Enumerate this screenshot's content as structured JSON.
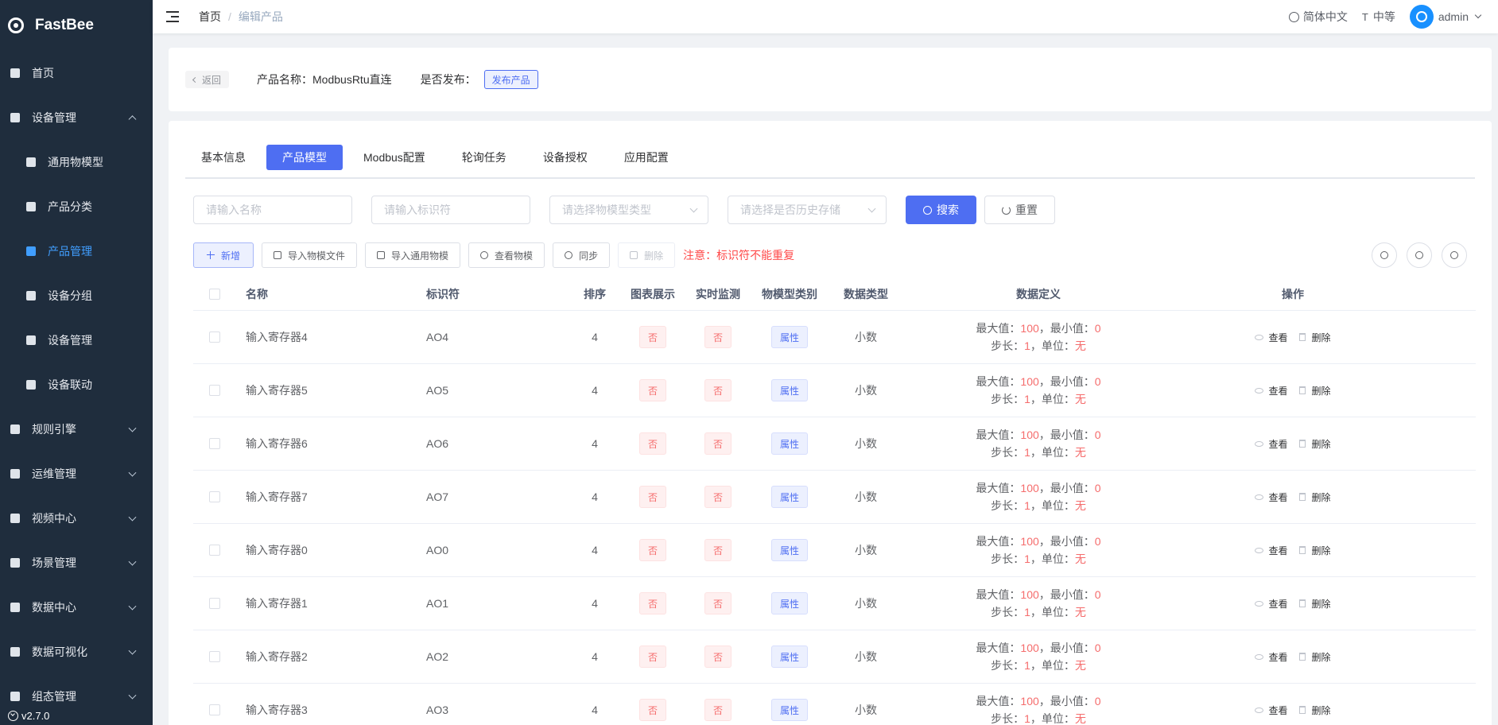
{
  "app": {
    "name": "FastBee",
    "version": "v2.7.0"
  },
  "sidebar": {
    "items": [
      {
        "label": "首页"
      },
      {
        "label": "设备管理"
      },
      {
        "label": "通用物模型"
      },
      {
        "label": "产品分类"
      },
      {
        "label": "产品管理"
      },
      {
        "label": "设备分组"
      },
      {
        "label": "设备管理"
      },
      {
        "label": "设备联动"
      },
      {
        "label": "规则引擎"
      },
      {
        "label": "运维管理"
      },
      {
        "label": "视频中心"
      },
      {
        "label": "场景管理"
      },
      {
        "label": "数据中心"
      },
      {
        "label": "数据可视化"
      },
      {
        "label": "组态管理"
      }
    ]
  },
  "header": {
    "breadcrumb": {
      "home": "首页",
      "sep": "/",
      "current": "编辑产品"
    },
    "language": "简体中文",
    "size": "中等",
    "user": "admin"
  },
  "product_bar": {
    "back_label": "返回",
    "product_name": "产品名称：ModbusRtu直连",
    "publish_label": "是否发布：",
    "publish_button": "发布产品"
  },
  "tabs": [
    {
      "label": "基本信息"
    },
    {
      "label": "产品模型"
    },
    {
      "label": "Modbus配置"
    },
    {
      "label": "轮询任务"
    },
    {
      "label": "设备授权"
    },
    {
      "label": "应用配置"
    }
  ],
  "filters": {
    "name_placeholder": "请输入名称",
    "identifier_placeholder": "请输入标识符",
    "model_type_placeholder": "请选择物模型类型",
    "history_placeholder": "请选择是否历史存储",
    "search_label": "搜索",
    "reset_label": "重置"
  },
  "toolbar": {
    "add": "新增",
    "import_file": "导入物模文件",
    "import_common": "导入通用物模",
    "view": "查看物模",
    "sync": "同步",
    "delete": "删除",
    "warning": "注意：标识符不能重复"
  },
  "table": {
    "headers": {
      "name": "名称",
      "identifier": "标识符",
      "order": "排序",
      "chart": "图表展示",
      "monitor": "实时监测",
      "category": "物模型类别",
      "data_type": "数据类型",
      "definition": "数据定义",
      "ops": "操作"
    },
    "labels": {
      "max": "最大值：",
      "min": "，最小值：",
      "step": "步长：",
      "unit": "，单位：",
      "view": "查看",
      "delete": "删除"
    },
    "rows": [
      {
        "name": "输入寄存器4",
        "identifier": "AO4",
        "order": "4",
        "chart": "否",
        "monitor": "否",
        "category": "属性",
        "data_type": "小数",
        "max": "100",
        "min": "0",
        "step": "1",
        "unit": "无"
      },
      {
        "name": "输入寄存器5",
        "identifier": "AO5",
        "order": "4",
        "chart": "否",
        "monitor": "否",
        "category": "属性",
        "data_type": "小数",
        "max": "100",
        "min": "0",
        "step": "1",
        "unit": "无"
      },
      {
        "name": "输入寄存器6",
        "identifier": "AO6",
        "order": "4",
        "chart": "否",
        "monitor": "否",
        "category": "属性",
        "data_type": "小数",
        "max": "100",
        "min": "0",
        "step": "1",
        "unit": "无"
      },
      {
        "name": "输入寄存器7",
        "identifier": "AO7",
        "order": "4",
        "chart": "否",
        "monitor": "否",
        "category": "属性",
        "data_type": "小数",
        "max": "100",
        "min": "0",
        "step": "1",
        "unit": "无"
      },
      {
        "name": "输入寄存器0",
        "identifier": "AO0",
        "order": "4",
        "chart": "否",
        "monitor": "否",
        "category": "属性",
        "data_type": "小数",
        "max": "100",
        "min": "0",
        "step": "1",
        "unit": "无"
      },
      {
        "name": "输入寄存器1",
        "identifier": "AO1",
        "order": "4",
        "chart": "否",
        "monitor": "否",
        "category": "属性",
        "data_type": "小数",
        "max": "100",
        "min": "0",
        "step": "1",
        "unit": "无"
      },
      {
        "name": "输入寄存器2",
        "identifier": "AO2",
        "order": "4",
        "chart": "否",
        "monitor": "否",
        "category": "属性",
        "data_type": "小数",
        "max": "100",
        "min": "0",
        "step": "1",
        "unit": "无"
      },
      {
        "name": "输入寄存器3",
        "identifier": "AO3",
        "order": "4",
        "chart": "否",
        "monitor": "否",
        "category": "属性",
        "data_type": "小数",
        "max": "100",
        "min": "0",
        "step": "1",
        "unit": "无"
      }
    ]
  },
  "colors": {
    "primary": "#4e6ef2",
    "sidebar": "#1f2d3d",
    "danger": "#f56c6c",
    "active_menu": "#409eff"
  }
}
